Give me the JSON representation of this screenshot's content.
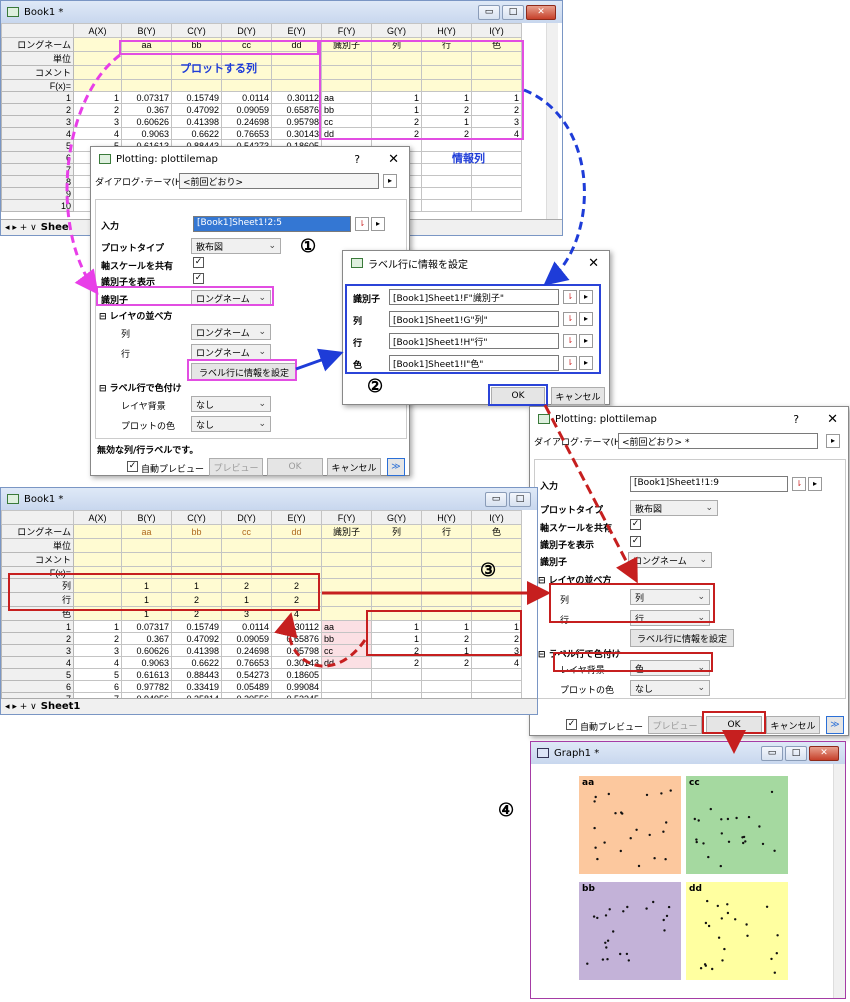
{
  "book1_top": {
    "title": "Book1 *",
    "cols": [
      "A(X)",
      "B(Y)",
      "C(Y)",
      "D(Y)",
      "E(Y)",
      "F(Y)",
      "G(Y)",
      "H(Y)",
      "I(Y)"
    ],
    "hdr_rows": [
      {
        "label": "ロングネーム",
        "vals": [
          "",
          "aa",
          "bb",
          "cc",
          "dd",
          "識別子",
          "列",
          "行",
          "色"
        ]
      },
      {
        "label": "単位",
        "vals": [
          "",
          "",
          "",
          "",
          "",
          "",
          "",
          "",
          ""
        ]
      },
      {
        "label": "コメント",
        "vals": [
          "",
          "",
          "",
          "",
          "",
          "",
          "",
          "",
          ""
        ]
      },
      {
        "label": "F(x)=",
        "vals": [
          "",
          "",
          "",
          "",
          "",
          "",
          "",
          "",
          ""
        ]
      }
    ],
    "rows": [
      [
        "1",
        "1",
        "0.07317",
        "0.15749",
        "0.0114",
        "0.30112",
        "aa",
        "1",
        "1",
        "1"
      ],
      [
        "2",
        "2",
        "0.367",
        "0.47092",
        "0.09059",
        "0.65876",
        "bb",
        "1",
        "2",
        "2"
      ],
      [
        "3",
        "3",
        "0.60626",
        "0.41398",
        "0.24698",
        "0.95798",
        "cc",
        "2",
        "1",
        "3"
      ],
      [
        "4",
        "4",
        "0.9063",
        "0.6622",
        "0.76653",
        "0.30143",
        "dd",
        "2",
        "2",
        "4"
      ],
      [
        "5",
        "5",
        "0.61613",
        "0.88443",
        "0.54273",
        "0.18605",
        "",
        "",
        "",
        ""
      ],
      [
        "6",
        "",
        "",
        "",
        "",
        "",
        "",
        "",
        "",
        ""
      ],
      [
        "7",
        "",
        "",
        "",
        "",
        "",
        "",
        "",
        "",
        ""
      ],
      [
        "8",
        "",
        "",
        "",
        "",
        "",
        "",
        "",
        "",
        ""
      ],
      [
        "9",
        "",
        "",
        "",
        "",
        "",
        "",
        "",
        "",
        ""
      ],
      [
        "10",
        "",
        "",
        "",
        "",
        "",
        "",
        "",
        "",
        ""
      ]
    ],
    "sheet_tab": "Shee"
  },
  "annot_plot_cols": "プロットする列",
  "annot_info_cols": "情報列",
  "dlg1": {
    "title": "Plotting: plottilemap",
    "q": "?",
    "close": "✕",
    "theme_label": "ダイアログ･テーマ(H)",
    "theme_value": "<前回どおり>",
    "input_label": "入力",
    "input_value": "[Book1]Sheet1!2:5",
    "plottype_label": "プロットタイプ",
    "plottype_value": "散布図",
    "share_label": "軸スケールを共有",
    "showid_label": "識別子を表示",
    "id_label": "識別子",
    "id_value": "ロングネーム",
    "layer_sect": "⊟ レイヤの並べ方",
    "col_label": "列",
    "col_value": "ロングネーム",
    "row_label": "行",
    "row_value": "ロングネーム",
    "set_btn": "ラベル行に情報を設定",
    "color_sect": "⊟ ラベル行で色付け",
    "bg_label": "レイヤ背景",
    "bg_value": "なし",
    "plotcolor_label": "プロットの色",
    "plotcolor_value": "なし",
    "status": "無効な列/行ラベルです。",
    "autoprev": "自動プレビュー",
    "prev_btn": "プレビュー",
    "ok_btn": "OK",
    "cancel_btn": "キャンセル",
    "more_btn": "≫"
  },
  "dlg2": {
    "title": "ラベル行に情報を設定",
    "close": "✕",
    "rows": [
      {
        "label": "識別子",
        "value": "[Book1]Sheet1!F\"識別子\""
      },
      {
        "label": "列",
        "value": "[Book1]Sheet1!G\"列\""
      },
      {
        "label": "行",
        "value": "[Book1]Sheet1!H\"行\""
      },
      {
        "label": "色",
        "value": "[Book1]Sheet1!I\"色\""
      }
    ],
    "ok_btn": "OK",
    "cancel_btn": "キャンセル"
  },
  "dlg3": {
    "title": "Plotting: plottilemap",
    "q": "?",
    "close": "✕",
    "theme_label": "ダイアログ･テーマ(H)",
    "theme_value": "<前回どおり> *",
    "input_label": "入力",
    "input_value": "[Book1]Sheet1!1:9",
    "plottype_label": "プロットタイプ",
    "plottype_value": "散布図",
    "share_label": "軸スケールを共有",
    "showid_label": "識別子を表示",
    "id_label": "識別子",
    "id_value": "ロングネーム",
    "layer_sect": "⊟ レイヤの並べ方",
    "col_label": "列",
    "col_value": "列",
    "row_label": "行",
    "row_value": "行",
    "set_btn": "ラベル行に情報を設定",
    "color_sect": "⊟ ラベル行で色付け",
    "bg_label": "レイヤ背景",
    "bg_value": "色",
    "plotcolor_label": "プロットの色",
    "plotcolor_value": "なし",
    "autoprev": "自動プレビュー",
    "prev_btn": "プレビュー",
    "ok_btn": "OK",
    "cancel_btn": "キャンセル",
    "more_btn": "≫"
  },
  "book1_bot": {
    "title": "Book1 *",
    "cols": [
      "A(X)",
      "B(Y)",
      "C(Y)",
      "D(Y)",
      "E(Y)",
      "F(Y)",
      "G(Y)",
      "H(Y)",
      "I(Y)"
    ],
    "hdr_rows": [
      {
        "label": "ロングネーム",
        "vals": [
          "",
          "aa",
          "bb",
          "cc",
          "dd",
          "識別子",
          "列",
          "行",
          "色"
        ]
      },
      {
        "label": "単位",
        "vals": [
          "",
          "",
          "",
          "",
          "",
          "",
          "",
          "",
          ""
        ]
      },
      {
        "label": "コメント",
        "vals": [
          "",
          "",
          "",
          "",
          "",
          "",
          "",
          "",
          ""
        ]
      },
      {
        "label": "F(x)=",
        "vals": [
          "",
          "",
          "",
          "",
          "",
          "",
          "",
          "",
          ""
        ]
      },
      {
        "label": "列",
        "vals": [
          "",
          "1",
          "1",
          "2",
          "2",
          "",
          "",
          "",
          ""
        ]
      },
      {
        "label": "行",
        "vals": [
          "",
          "1",
          "2",
          "1",
          "2",
          "",
          "",
          "",
          ""
        ]
      },
      {
        "label": "色",
        "vals": [
          "",
          "1",
          "2",
          "3",
          "4",
          "",
          "",
          "",
          ""
        ]
      }
    ],
    "rows": [
      [
        "1",
        "1",
        "0.07317",
        "0.15749",
        "0.0114",
        "0.30112",
        "aa",
        "1",
        "1",
        "1"
      ],
      [
        "2",
        "2",
        "0.367",
        "0.47092",
        "0.09059",
        "0.65876",
        "bb",
        "1",
        "2",
        "2"
      ],
      [
        "3",
        "3",
        "0.60626",
        "0.41398",
        "0.24698",
        "0.95798",
        "cc",
        "2",
        "1",
        "3"
      ],
      [
        "4",
        "4",
        "0.9063",
        "0.6622",
        "0.76653",
        "0.30143",
        "dd",
        "2",
        "2",
        "4"
      ],
      [
        "5",
        "5",
        "0.61613",
        "0.88443",
        "0.54273",
        "0.18605",
        "",
        "",
        "",
        ""
      ],
      [
        "6",
        "6",
        "0.97782",
        "0.33419",
        "0.05489",
        "0.99084",
        "",
        "",
        "",
        ""
      ],
      [
        "7",
        "7",
        "0.94956",
        "0.35814",
        "0.20556",
        "0.53345",
        "",
        "",
        "",
        ""
      ]
    ],
    "sheet_tab": "Sheet1"
  },
  "graph": {
    "title": "Graph1 *",
    "tiles": [
      {
        "label": "aa",
        "color": "#fcc89e"
      },
      {
        "label": "cc",
        "color": "#a5d9a0"
      },
      {
        "label": "bb",
        "color": "#c3b2d8"
      },
      {
        "label": "dd",
        "color": "#ffffa0"
      }
    ]
  },
  "steps": [
    "①",
    "②",
    "③",
    "④"
  ]
}
